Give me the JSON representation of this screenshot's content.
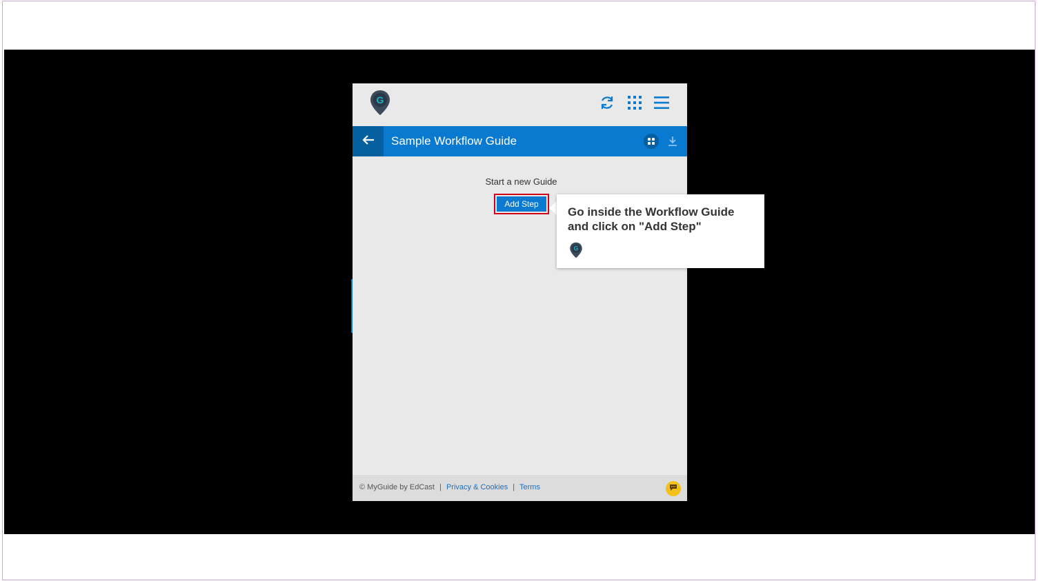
{
  "panel": {
    "topbar": {
      "logo_icon": "myguide-pin-logo-icon",
      "icons": [
        "refresh-icon",
        "grid-dots-icon",
        "hamburger-menu-icon"
      ]
    },
    "titlebar": {
      "back_icon": "arrow-left-icon",
      "title": "Sample Workflow Guide",
      "icons": [
        "apps-icon",
        "download-icon"
      ]
    },
    "content": {
      "start_text": "Start a new Guide",
      "add_step_label": "Add Step"
    },
    "footer": {
      "copyright": "© MyGuide by EdCast",
      "privacy_link": "Privacy & Cookies",
      "terms_link": "Terms",
      "separator": "|",
      "chat_icon": "chat-bubble-icon"
    }
  },
  "tooltip": {
    "text": "Go inside the Workflow Guide and click on \"Add Step\"",
    "logo_icon": "myguide-pin-logo-icon"
  },
  "colors": {
    "accent_blue": "#0a7ad1",
    "back_blue": "#065f9f",
    "highlight_red": "#d0021b",
    "chat_yellow": "#f2c21b",
    "panel_bg": "#e9e9ea"
  }
}
